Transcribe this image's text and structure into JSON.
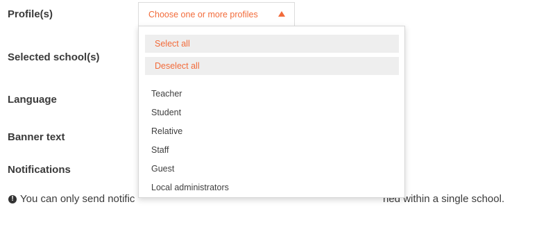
{
  "form": {
    "labels": {
      "profiles": "Profile(s)",
      "schools": "Selected school(s)",
      "language": "Language",
      "banner": "Banner text",
      "notifications": "Notifications"
    },
    "profiles_select": {
      "placeholder": "Choose one or more profiles",
      "open": true,
      "select_all": "Select all",
      "deselect_all": "Deselect all",
      "options": [
        "Teacher",
        "Student",
        "Relative",
        "Staff",
        "Guest",
        "Local administrators"
      ]
    },
    "info": {
      "icon": "exclamation-circle-icon",
      "text_visible_start": "You can only send notific",
      "text_visible_end": "ned within a single school."
    }
  },
  "colors": {
    "accent": "#f26b3a",
    "label": "#3a3a3a",
    "button_bg": "#eeeeee"
  }
}
